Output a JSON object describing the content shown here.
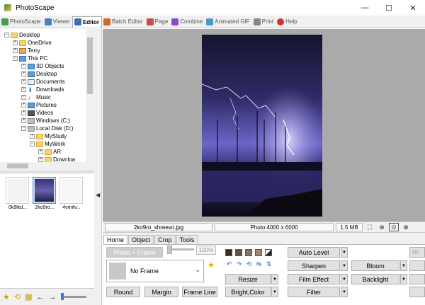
{
  "window": {
    "title": "PhotoScape",
    "minimize": "—",
    "maximize": "☐",
    "close": "✕"
  },
  "tabs": [
    {
      "label": "PhotoScape",
      "color": "#4a9c4a"
    },
    {
      "label": "Viewer",
      "color": "#4a7fc8"
    },
    {
      "label": "Editor",
      "color": "#3a6fb8"
    },
    {
      "label": "Batch Editor",
      "color": "#c86a2a"
    },
    {
      "label": "Page",
      "color": "#c84a4a"
    },
    {
      "label": "Combine",
      "color": "#8a4ac8"
    },
    {
      "label": "Animated GIF",
      "color": "#4a9cc8"
    },
    {
      "label": "Print",
      "color": "#888888"
    },
    {
      "label": "Help",
      "color": "#d83030"
    }
  ],
  "tree": {
    "items": [
      {
        "label": "Desktop",
        "exp": "−",
        "icon": "folder"
      },
      {
        "label": "OneDrive",
        "exp": "+",
        "icon": "folder"
      },
      {
        "label": "Terry",
        "exp": "+",
        "icon": "user"
      },
      {
        "label": "This PC",
        "exp": "−",
        "icon": "pc"
      },
      {
        "label": "3D Objects",
        "exp": "+",
        "icon": "pc"
      },
      {
        "label": "Desktop",
        "exp": "+",
        "icon": "pc"
      },
      {
        "label": "Documents",
        "exp": "+",
        "icon": "pc"
      },
      {
        "label": "Downloads",
        "exp": "+",
        "icon": "pc"
      },
      {
        "label": "Music",
        "exp": "+",
        "icon": "pc"
      },
      {
        "label": "Pictures",
        "exp": "+",
        "icon": "pc"
      },
      {
        "label": "Videos",
        "exp": "+",
        "icon": "pc"
      },
      {
        "label": "Windows (C:)",
        "exp": "+",
        "icon": "drive"
      },
      {
        "label": "Local Disk (D:)",
        "exp": "−",
        "icon": "drive"
      },
      {
        "label": "MyStudy",
        "exp": "+",
        "icon": "folder"
      },
      {
        "label": "MyWork",
        "exp": "−",
        "icon": "folder"
      },
      {
        "label": "AR",
        "exp": "+",
        "icon": "folder"
      },
      {
        "label": "Downloa",
        "exp": "+",
        "icon": "folder"
      }
    ]
  },
  "thumbnails": [
    {
      "caption": "0k9lkd...",
      "selected": false
    },
    {
      "caption": "2ko9ro...",
      "selected": true
    },
    {
      "caption": "4vmifv...",
      "selected": false
    }
  ],
  "status": {
    "filename": "2ko9ro_shreevo.jpg",
    "dimensions": "Photo 4000 x 6000",
    "filesize": "1.5 MB"
  },
  "edit_tabs": [
    "Home",
    "Object",
    "Crop",
    "Tools"
  ],
  "home": {
    "photo_frame": "Photo + Frame",
    "percent": "100%",
    "frame_select": "No Frame",
    "round": "Round",
    "margin": "Margin",
    "frame_line": "Frame Line",
    "resize": "Resize",
    "bright_color": "Bright,Color",
    "auto_level": "Auto Level",
    "sharpen": "Sharpen",
    "film_effect": "Film Effect",
    "filter": "Filter",
    "bloom": "Bloom",
    "backlight": "Backlight",
    "right_strip": "Un"
  }
}
